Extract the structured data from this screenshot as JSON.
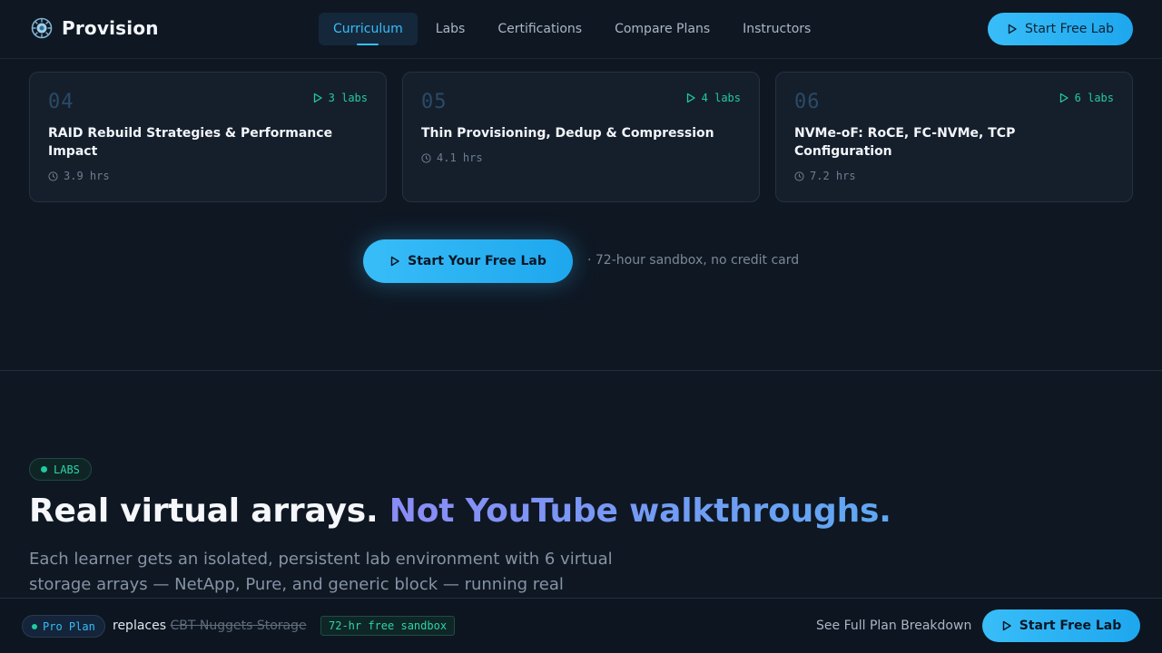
{
  "brand": {
    "name": "Provision"
  },
  "nav": {
    "links": [
      "Curriculum",
      "Labs",
      "Certifications",
      "Compare Plans",
      "Instructors"
    ],
    "active": "Curriculum",
    "cta_label": "Start Free Lab"
  },
  "modules": [
    {
      "num": "04",
      "labs": "3 labs",
      "title": "RAID Rebuild Strategies & Performance Impact",
      "hours": "3.9 hrs"
    },
    {
      "num": "05",
      "labs": "4 labs",
      "title": "Thin Provisioning, Dedup & Compression",
      "hours": "4.1 hrs"
    },
    {
      "num": "06",
      "labs": "6 labs",
      "title": "NVMe-oF: RoCE, FC-NVMe, TCP Configuration",
      "hours": "7.2 hrs"
    }
  ],
  "mid_cta": {
    "label": "Start Your Free Lab",
    "note": "· 72-hour sandbox, no credit card"
  },
  "labs_section": {
    "badge": "LABS",
    "headline_plain": "Real virtual arrays.",
    "headline_accent": "Not YouTube walkthroughs.",
    "lede": "Each learner gets an isolated, persistent lab environment with 6 virtual storage arrays — NetApp, Pure, and generic block — running real"
  },
  "sticky_bar": {
    "plan": "Pro Plan",
    "replaces_label": "replaces",
    "replaced_product": "CBT Nuggets Storage",
    "sandbox_tag": "72-hr free sandbox",
    "plan_link": "See Full Plan Breakdown",
    "cta_label": "Start Free Lab"
  },
  "colors": {
    "background": "#0f1723",
    "accent": "#38bdf8",
    "success": "#22c9a0",
    "headline_gradient_start": "#8b8cf5",
    "headline_gradient_end": "#5ea8f2"
  }
}
